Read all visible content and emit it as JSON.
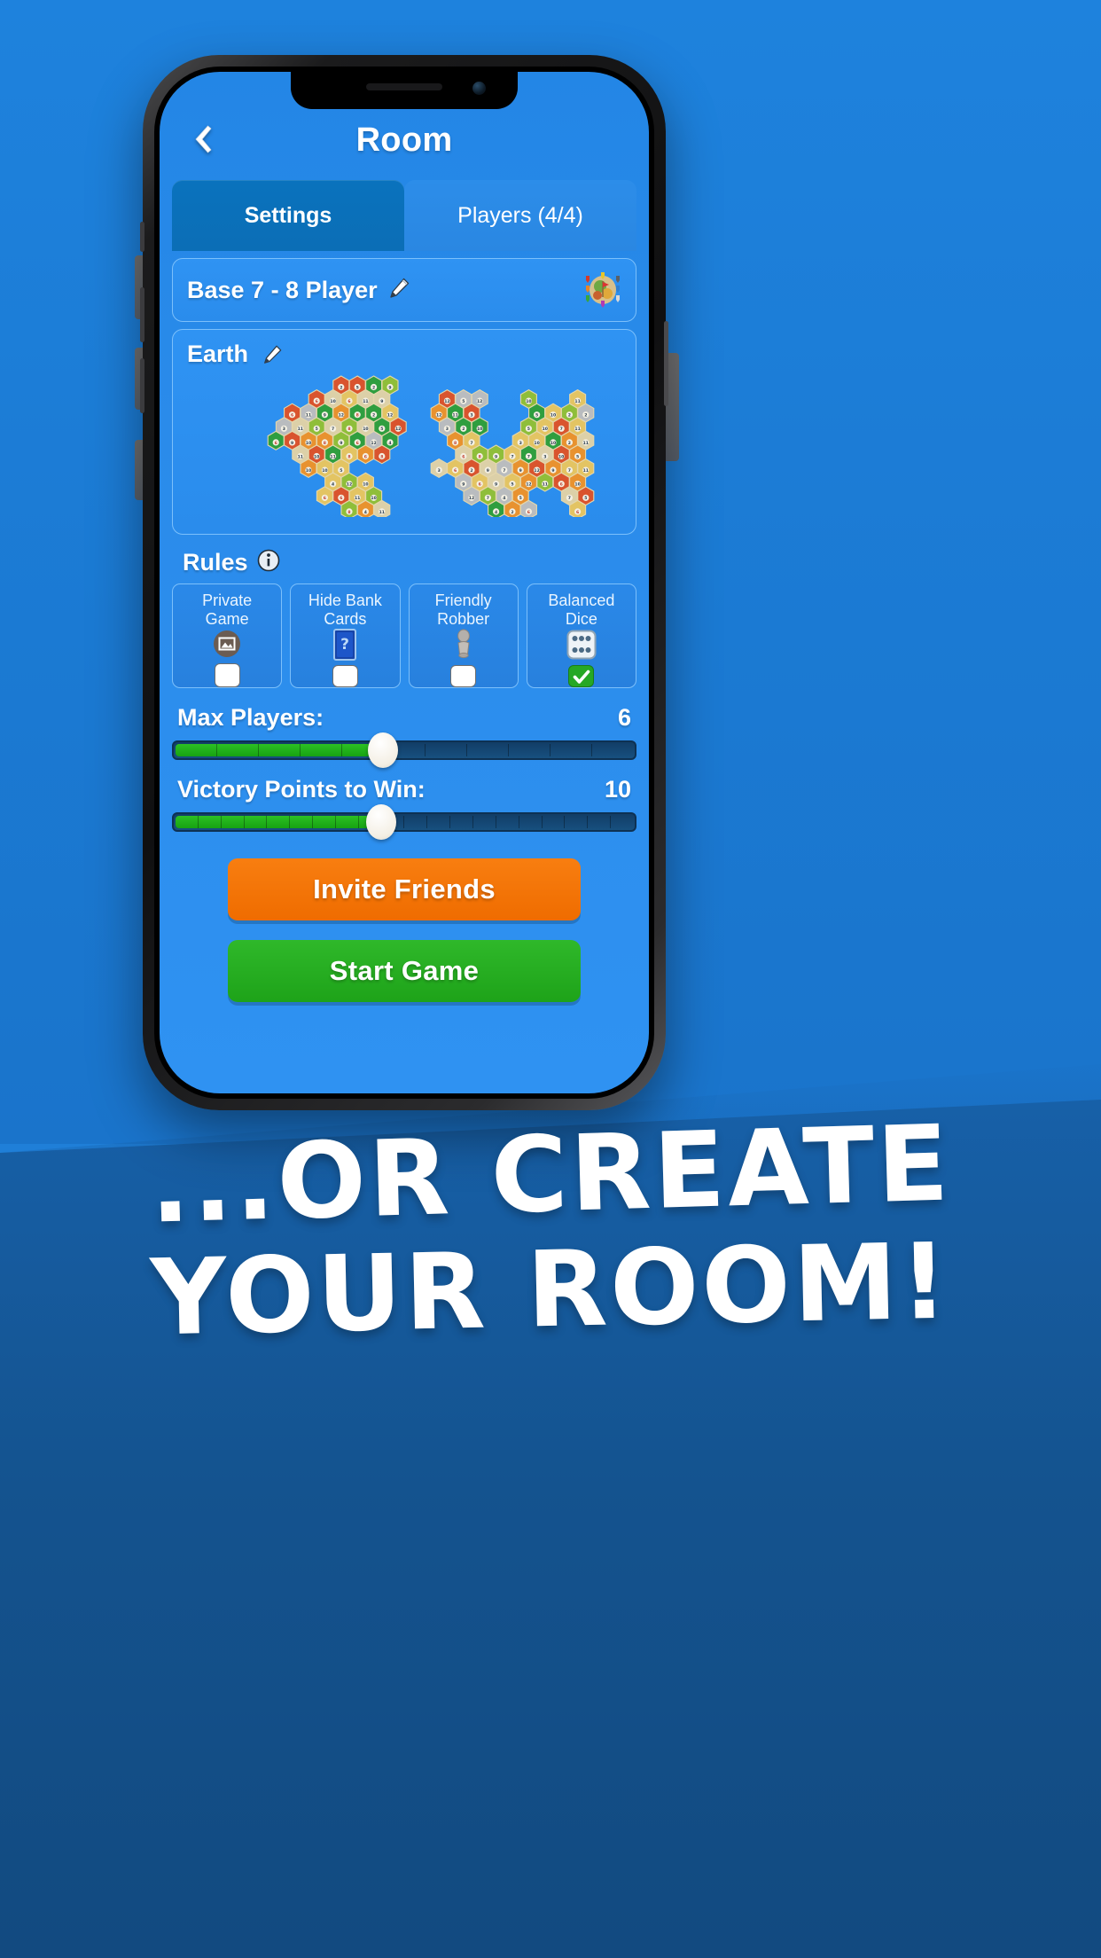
{
  "header": {
    "title": "Room",
    "back_icon": "chevron-left-icon"
  },
  "tabs": [
    {
      "label": "Settings",
      "active": true
    },
    {
      "label": "Players (4/4)",
      "active": false
    }
  ],
  "scenario": {
    "label": "Base 7 - 8 Player",
    "edit_icon": "pencil-icon",
    "thumbnail_icon": "board-thumbnail-icon"
  },
  "map": {
    "label": "Earth",
    "edit_icon": "pencil-icon"
  },
  "rules": {
    "label": "Rules",
    "info_icon": "info-icon",
    "items": [
      {
        "label": "Private\nGame",
        "icon": "image-placeholder-icon",
        "checked": false
      },
      {
        "label": "Hide Bank\nCards",
        "icon": "question-card-icon",
        "checked": false
      },
      {
        "label": "Friendly\nRobber",
        "icon": "robber-pawn-icon",
        "checked": false
      },
      {
        "label": "Balanced\nDice",
        "icon": "dice-icon",
        "checked": true
      }
    ]
  },
  "sliders": [
    {
      "name": "Max Players:",
      "value": "6",
      "min": 2,
      "max": 12,
      "current": 6,
      "segments": 11,
      "filled": 5
    },
    {
      "name": "Victory Points to Win:",
      "value": "10",
      "min": 3,
      "max": 22,
      "current": 10,
      "segments": 20,
      "filled": 9
    }
  ],
  "actions": {
    "invite_label": "Invite Friends",
    "start_label": "Start Game"
  },
  "promo": {
    "line1": "...OR CREATE",
    "line2": "YOUR ROOM!"
  },
  "colors": {
    "brand_blue": "#2a8cec",
    "tab_active": "#0b6eb6",
    "orange": "#ef6c00",
    "green": "#1ea319",
    "slider_fill": "#17a312",
    "slider_empty": "#17507f",
    "page_bg_top": "#1e82dd",
    "page_bg_bottom": "#124a80"
  }
}
